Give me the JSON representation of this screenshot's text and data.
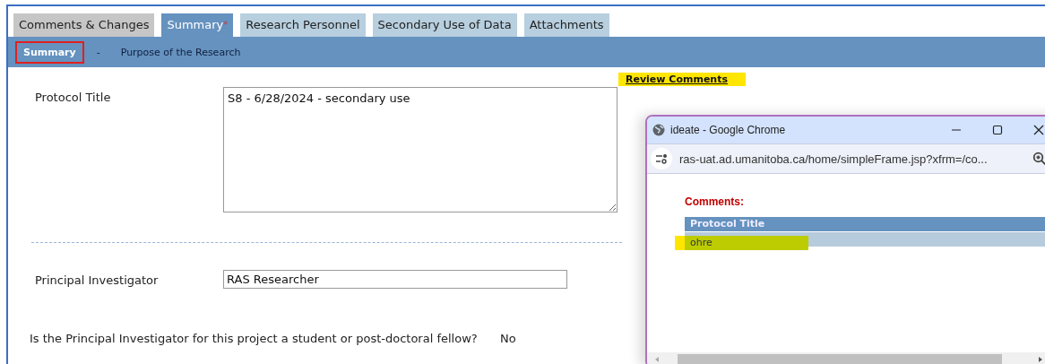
{
  "tabs": [
    {
      "label": "Comments & Changes",
      "kind": "comments",
      "selected": false
    },
    {
      "label": "Summary",
      "kind": "section",
      "selected": true,
      "marker": "*"
    },
    {
      "label": "Research Personnel",
      "kind": "section",
      "selected": false
    },
    {
      "label": "Secondary Use of Data",
      "kind": "section",
      "selected": false
    },
    {
      "label": "Attachments",
      "kind": "section",
      "selected": false
    }
  ],
  "subnav": {
    "items": [
      {
        "label": "Summary",
        "selected": true
      },
      {
        "label": "Purpose of the Research",
        "selected": false
      }
    ],
    "separator": "-"
  },
  "fields": [
    {
      "label": "Protocol Title",
      "kind": "textarea",
      "value": "S8 - 6/28/2024 - secondary use"
    },
    {
      "label": "Principal Investigator",
      "kind": "input",
      "value": "RAS Researcher"
    },
    {
      "label": "Is the Principal Investigator for this project a student or post-doctoral fellow?",
      "kind": "answer",
      "value": "No"
    }
  ],
  "review_link": {
    "label": "Review Comments",
    "highlighted": true
  },
  "popup": {
    "title": "ideate - Google Chrome",
    "url": "ras-uat.ad.umanitoba.ca/home/simpleFrame.jsp?xfrm=/co...",
    "heading": "Comments:",
    "table": {
      "columns": [
        "Protocol Title"
      ],
      "rows": [
        {
          "cells": [
            "ohre"
          ],
          "highlighted": true
        }
      ]
    }
  }
}
